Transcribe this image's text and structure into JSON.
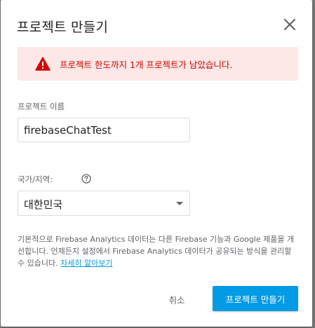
{
  "dialog": {
    "title": "프로젝트 만들기",
    "close_icon": "close-icon"
  },
  "warning": {
    "icon": "warning-triangle-icon",
    "text": "프로젝트 한도까지 1개 프로젝트가 남았습니다.",
    "text_color": "#d50000",
    "background_color": "#fce8e6"
  },
  "project_name": {
    "label": "프로젝트 이름",
    "value": "firebaseChatTest"
  },
  "region": {
    "label": "국가/지역:",
    "help_icon": "help-circle-icon",
    "selected": "대한민국"
  },
  "info": {
    "text": "기본적으로 Firebase Analytics 데이터는 다른 Firebase 기능과 Google 제품을 개선합니다. 언제든지 설정에서 Firebase Analytics 데이터가 공유되는 방식을 관리할 수 있습니다. ",
    "link": "자세히 알아보기"
  },
  "actions": {
    "cancel_label": "취소",
    "create_label": "프로젝트 만들기",
    "accent_color": "#039be5"
  }
}
